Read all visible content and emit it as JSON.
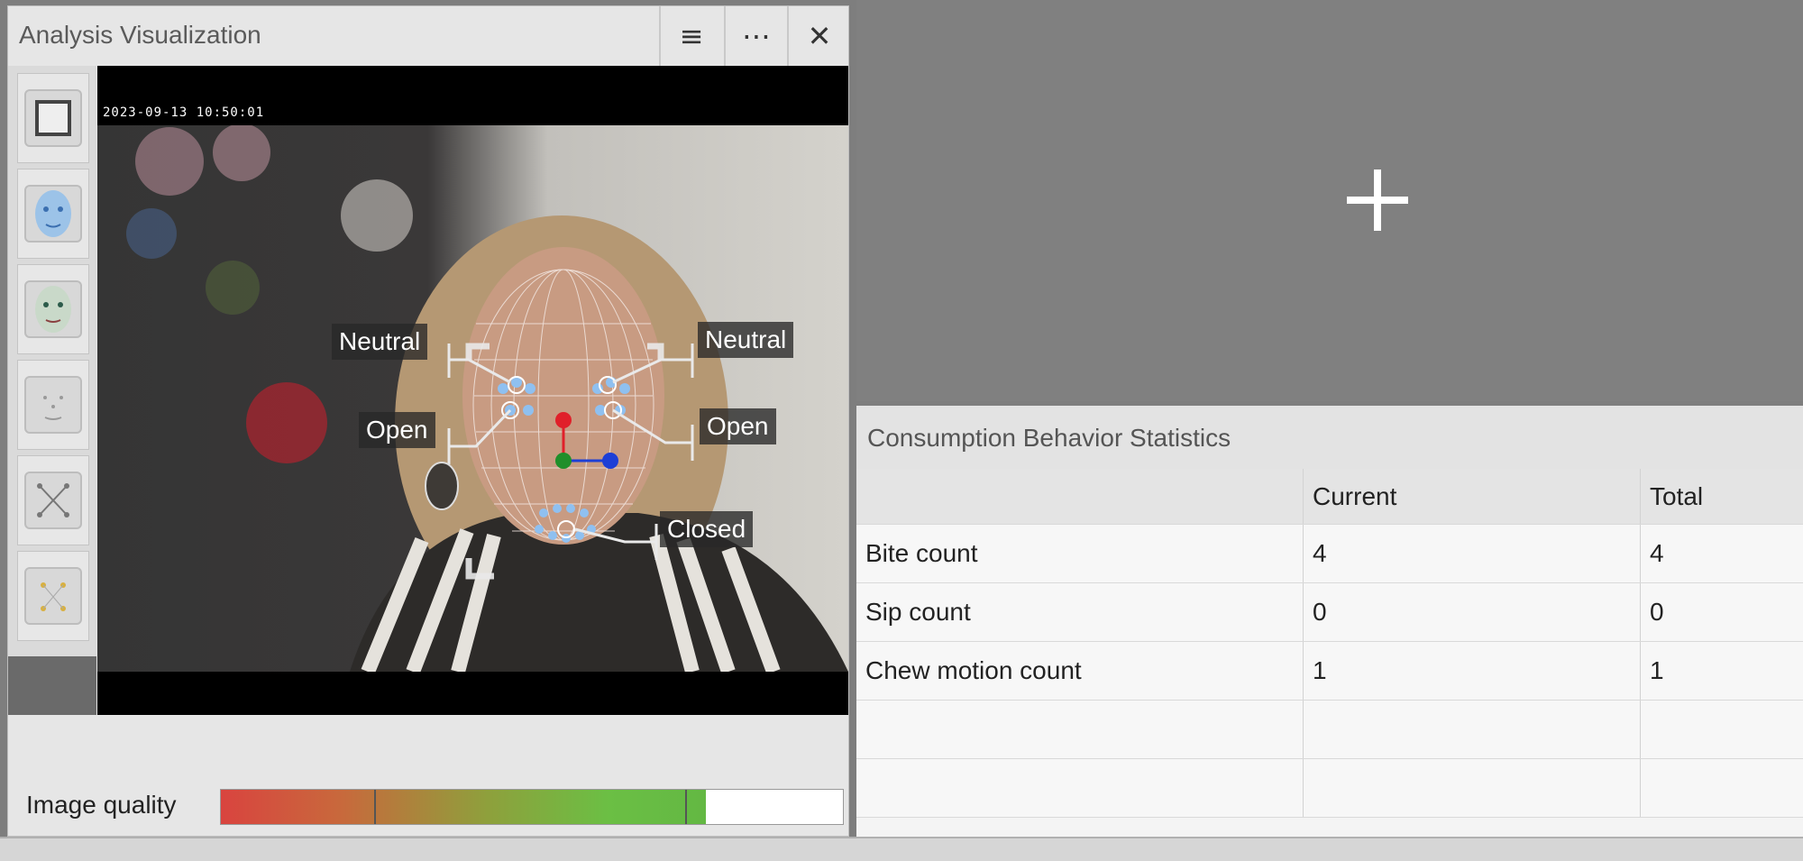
{
  "panel": {
    "title": "Analysis Visualization",
    "menu_icon": "≡",
    "more_icon": "⋯",
    "close_icon": "✕"
  },
  "video": {
    "timestamp": "2023-09-13 10:50:01",
    "labels": {
      "left_eyebrow": "Neutral",
      "right_eyebrow": "Neutral",
      "left_eye": "Open",
      "right_eye": "Open",
      "mouth": "Closed"
    }
  },
  "image_quality": {
    "label": "Image quality",
    "level_percent": 78
  },
  "stats": {
    "title": "Consumption Behavior Statistics",
    "columns": [
      "",
      "Current",
      "Total"
    ],
    "rows": [
      [
        "Bite count",
        "4",
        "4"
      ],
      [
        "Sip count",
        "0",
        "0"
      ],
      [
        "Chew motion count",
        "1",
        "1"
      ],
      [
        "",
        "",
        ""
      ],
      [
        "",
        "",
        ""
      ]
    ]
  },
  "colors": {
    "nose_point": "#e0202a",
    "center_point": "#1f8f2a",
    "side_point": "#1d3fd6",
    "landmark": "#8fc0f0"
  }
}
